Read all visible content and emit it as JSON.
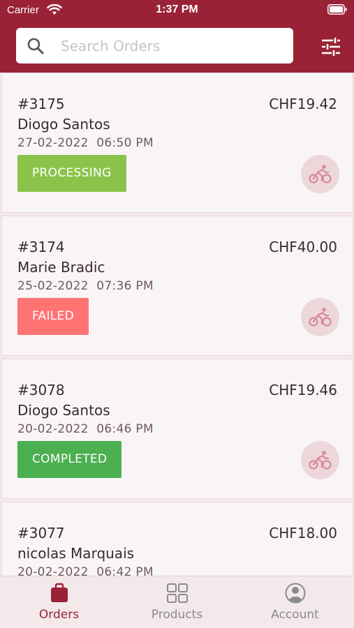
{
  "status_bar": {
    "carrier": "Carrier",
    "time": "1:37 PM"
  },
  "search": {
    "placeholder": "Search Orders",
    "value": ""
  },
  "orders": [
    {
      "number": "#3175",
      "total": "CHF19.42",
      "customer": "Diogo Santos",
      "date": "27-02-2022  06:50 PM",
      "status": "PROCESSING",
      "status_color": "#8bc34a"
    },
    {
      "number": "#3174",
      "total": "CHF40.00",
      "customer": "Marie Bradic",
      "date": "25-02-2022  07:36 PM",
      "status": "FAILED",
      "status_color": "#ff7373"
    },
    {
      "number": "#3078",
      "total": "CHF19.46",
      "customer": "Diogo Santos",
      "date": "20-02-2022  06:46 PM",
      "status": "COMPLETED",
      "status_color": "#4caf50"
    },
    {
      "number": "#3077",
      "total": "CHF18.00",
      "customer": "nicolas Marquais",
      "date": "20-02-2022  06:42 PM",
      "status": "",
      "status_color": ""
    }
  ],
  "tabs": [
    {
      "label": "Orders",
      "icon": "bag-icon",
      "active": true
    },
    {
      "label": "Products",
      "icon": "grid-icon",
      "active": false
    },
    {
      "label": "Account",
      "icon": "user-circle-icon",
      "active": false
    }
  ],
  "colors": {
    "brand": "#9a2236",
    "tab_active": "#9a2236",
    "tab_inactive": "#8a8a8a",
    "delivery_icon": "#d98a98"
  }
}
